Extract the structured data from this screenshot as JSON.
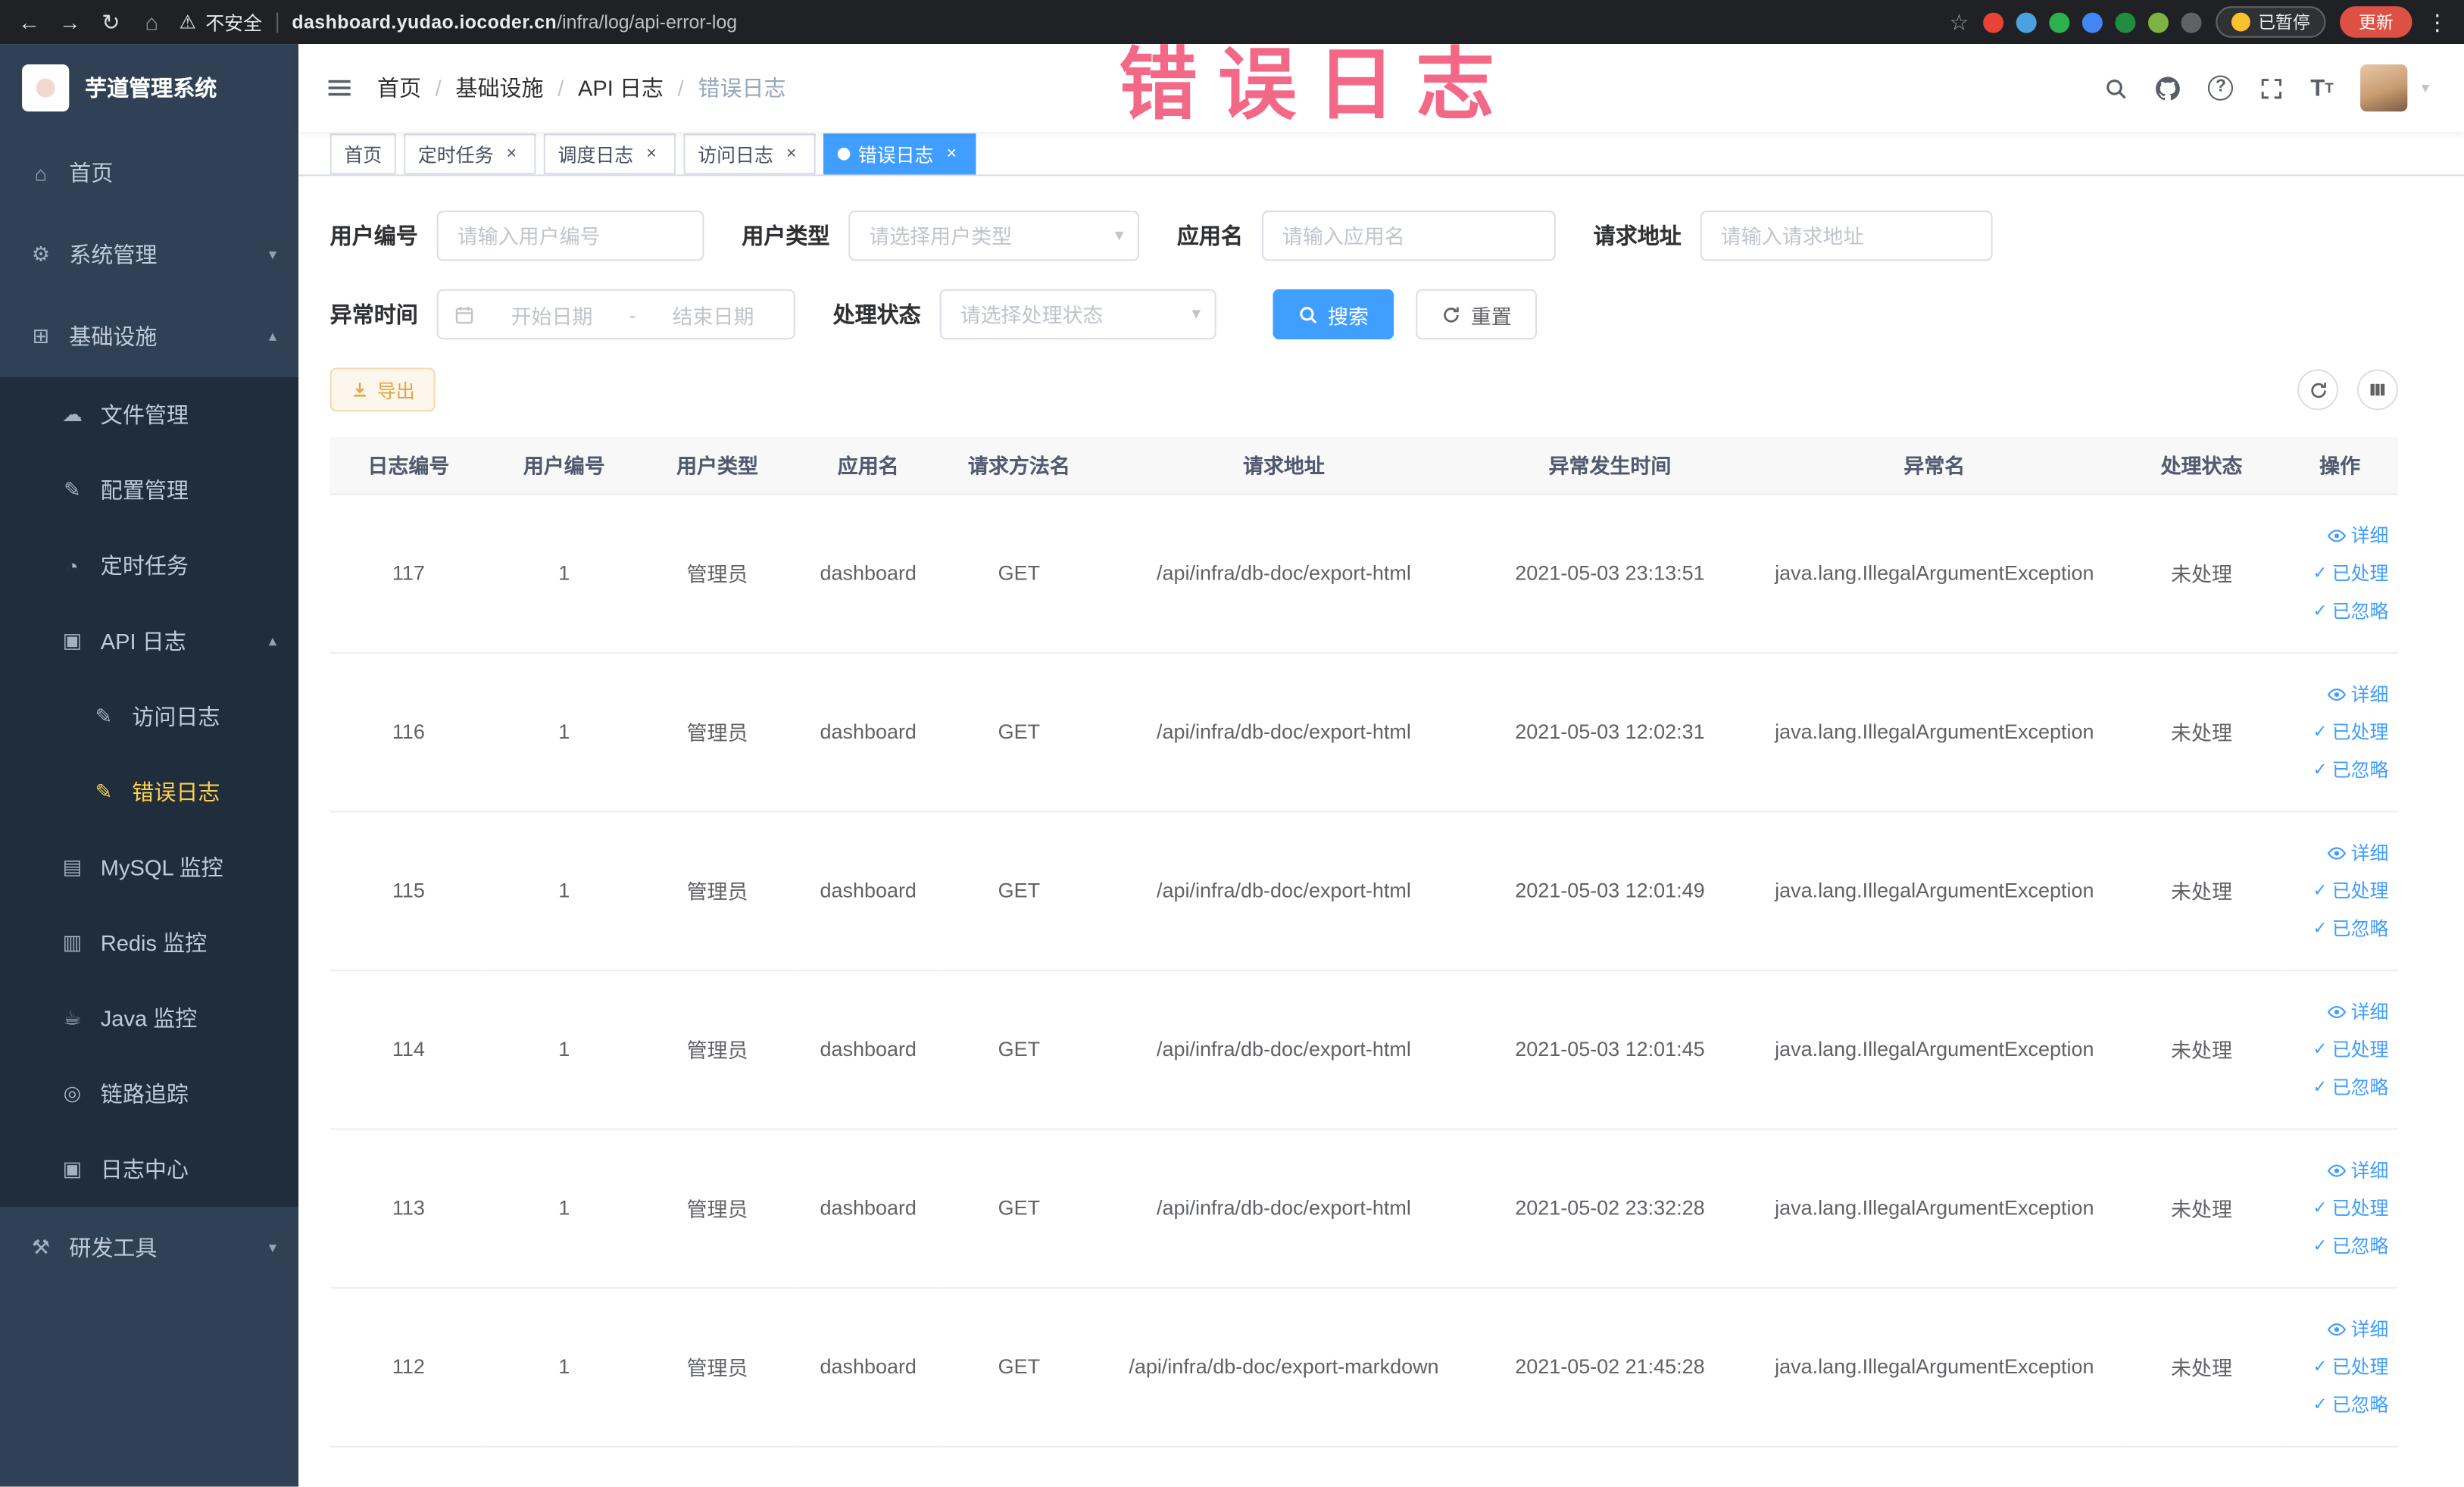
{
  "browser": {
    "security_label": "不安全",
    "url_host": "dashboard.yudao.iocoder.cn",
    "url_path": "/infra/log/api-error-log",
    "paused_badge": "已暂停",
    "update_button": "更新",
    "extensions": [
      "#ea4335",
      "#4aa3df",
      "#2bb24c",
      "#4285f4",
      "#1e8e3e",
      "#7cb342",
      "#5f6368"
    ]
  },
  "icons": {
    "back": "←",
    "forward": "→",
    "reload": "↻",
    "home_nav": "⌂",
    "warning": "⚠",
    "star": "☆",
    "kebab": "⋮",
    "caret_down": "▾",
    "chevron_down": "▾",
    "chevron_up": "▴",
    "check": "✓",
    "close": "×",
    "home": "⌂",
    "system": "⚙",
    "infra": "⊞",
    "file": "☁",
    "config": "✎",
    "job": "◔",
    "api_log": "▣",
    "access_log": "✎",
    "error_log": "✎",
    "mysql": "▤",
    "redis": "▥",
    "java": "☕",
    "trace": "◎",
    "log_center": "▣",
    "dev_tools": "⚒"
  },
  "annotation": {
    "text": "错误日志",
    "color": "#f2476d"
  },
  "sidebar": {
    "logo_title": "芋道管理系统",
    "items": {
      "home": "首页",
      "system": "系统管理",
      "infra": "基础设施",
      "file": "文件管理",
      "config": "配置管理",
      "job": "定时任务",
      "api_log": "API 日志",
      "access_log": "访问日志",
      "error_log": "错误日志",
      "mysql": "MySQL 监控",
      "redis": "Redis 监控",
      "java": "Java 监控",
      "trace": "链路追踪",
      "log_center": "日志中心",
      "dev_tools": "研发工具"
    }
  },
  "header": {
    "breadcrumb": [
      "首页",
      "基础设施",
      "API 日志",
      "错误日志"
    ],
    "separator": "/"
  },
  "tabs": [
    {
      "label": "首页"
    },
    {
      "label": "定时任务"
    },
    {
      "label": "调度日志"
    },
    {
      "label": "访问日志"
    },
    {
      "label": "错误日志"
    }
  ],
  "filters": {
    "user_id": {
      "label": "用户编号",
      "placeholder": "请输入用户编号"
    },
    "user_type": {
      "label": "用户类型",
      "placeholder": "请选择用户类型"
    },
    "app_name": {
      "label": "应用名",
      "placeholder": "请输入应用名"
    },
    "request_url": {
      "label": "请求地址",
      "placeholder": "请输入请求地址"
    },
    "exception_time": {
      "label": "异常时间",
      "start_placeholder": "开始日期",
      "separator": "-",
      "end_placeholder": "结束日期"
    },
    "process_status": {
      "label": "处理状态",
      "placeholder": "请选择处理状态"
    },
    "search_button": "搜索",
    "reset_button": "重置"
  },
  "toolbar": {
    "export_button": "导出"
  },
  "table": {
    "columns": [
      "日志编号",
      "用户编号",
      "用户类型",
      "应用名",
      "请求方法名",
      "请求地址",
      "异常发生时间",
      "异常名",
      "处理状态",
      "操作"
    ],
    "actions": [
      "详细",
      "已处理",
      "已忽略"
    ],
    "rows": [
      {
        "id": "117",
        "user_id": "1",
        "user_type": "管理员",
        "app": "dashboard",
        "method": "GET",
        "url": "/api/infra/db-doc/export-html",
        "time": "2021-05-03 23:13:51",
        "exception": "java.lang.IllegalArgumentException",
        "status": "未处理"
      },
      {
        "id": "116",
        "user_id": "1",
        "user_type": "管理员",
        "app": "dashboard",
        "method": "GET",
        "url": "/api/infra/db-doc/export-html",
        "time": "2021-05-03 12:02:31",
        "exception": "java.lang.IllegalArgumentException",
        "status": "未处理"
      },
      {
        "id": "115",
        "user_id": "1",
        "user_type": "管理员",
        "app": "dashboard",
        "method": "GET",
        "url": "/api/infra/db-doc/export-html",
        "time": "2021-05-03 12:01:49",
        "exception": "java.lang.IllegalArgumentException",
        "status": "未处理"
      },
      {
        "id": "114",
        "user_id": "1",
        "user_type": "管理员",
        "app": "dashboard",
        "method": "GET",
        "url": "/api/infra/db-doc/export-html",
        "time": "2021-05-03 12:01:45",
        "exception": "java.lang.IllegalArgumentException",
        "status": "未处理"
      },
      {
        "id": "113",
        "user_id": "1",
        "user_type": "管理员",
        "app": "dashboard",
        "method": "GET",
        "url": "/api/infra/db-doc/export-html",
        "time": "2021-05-02 23:32:28",
        "exception": "java.lang.IllegalArgumentException",
        "status": "未处理"
      },
      {
        "id": "112",
        "user_id": "1",
        "user_type": "管理员",
        "app": "dashboard",
        "method": "GET",
        "url": "/api/infra/db-doc/export-markdown",
        "time": "2021-05-02 21:45:28",
        "exception": "java.lang.IllegalArgumentException",
        "status": "未处理"
      }
    ]
  },
  "colors": {
    "accent": "#409eff",
    "active_menu_text": "#ffd04b",
    "sidebar_bg": "#304156",
    "submenu_bg": "#1f2d3d",
    "warning_text": "#e6a23c"
  }
}
